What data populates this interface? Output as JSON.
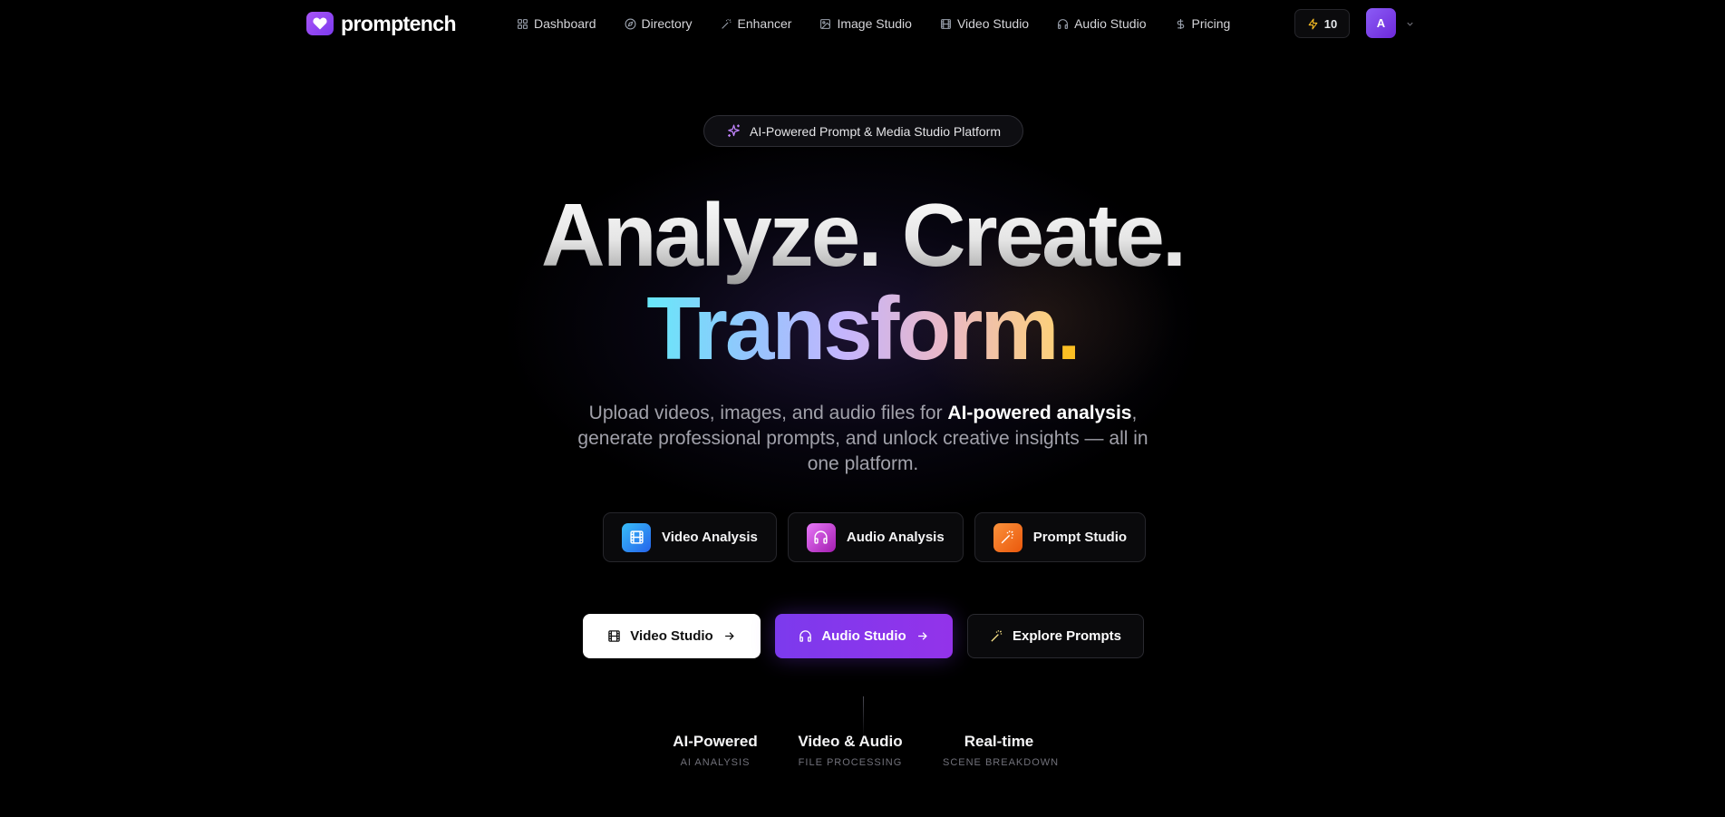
{
  "brand": {
    "name": "promptench",
    "logo_icon": "heart-icon"
  },
  "nav": {
    "links": [
      {
        "label": "Dashboard",
        "icon": "grid-icon"
      },
      {
        "label": "Directory",
        "icon": "compass-icon"
      },
      {
        "label": "Enhancer",
        "icon": "wand-icon"
      },
      {
        "label": "Image Studio",
        "icon": "image-icon"
      },
      {
        "label": "Video Studio",
        "icon": "film-icon"
      },
      {
        "label": "Audio Studio",
        "icon": "headphones-icon"
      },
      {
        "label": "Pricing",
        "icon": "dollar-icon"
      }
    ],
    "credits": "10",
    "avatar_initial": "A"
  },
  "hero": {
    "badge": "AI-Powered Prompt & Media Studio Platform",
    "headline_line1_word1": "Analyze",
    "headline_line1_word2": "Create",
    "headline_line2_word": "Transform",
    "headline_dot": ".",
    "subtitle_part1": "Upload videos, images, and audio files for ",
    "subtitle_emphasis": "AI-powered analysis",
    "subtitle_part2": ", generate professional prompts, and unlock creative insights — all in one platform."
  },
  "features": [
    {
      "label": "Video Analysis",
      "icon": "film-icon"
    },
    {
      "label": "Audio Analysis",
      "icon": "headphones-icon"
    },
    {
      "label": "Prompt Studio",
      "icon": "wand-icon"
    }
  ],
  "cta": {
    "video_studio": "Video Studio",
    "audio_studio": "Audio Studio",
    "explore_prompts": "Explore Prompts"
  },
  "stats": [
    {
      "title": "AI-Powered",
      "subtitle": "AI ANALYSIS"
    },
    {
      "title": "Video & Audio",
      "subtitle": "FILE PROCESSING"
    },
    {
      "title": "Real-time",
      "subtitle": "SCENE BREAKDOWN"
    }
  ],
  "colors": {
    "accent_purple": "#7c3aed",
    "credits_bolt": "#fbbf24",
    "transform_gradient": [
      "#67e8f9",
      "#c4b5fd",
      "#fcd07a"
    ]
  }
}
